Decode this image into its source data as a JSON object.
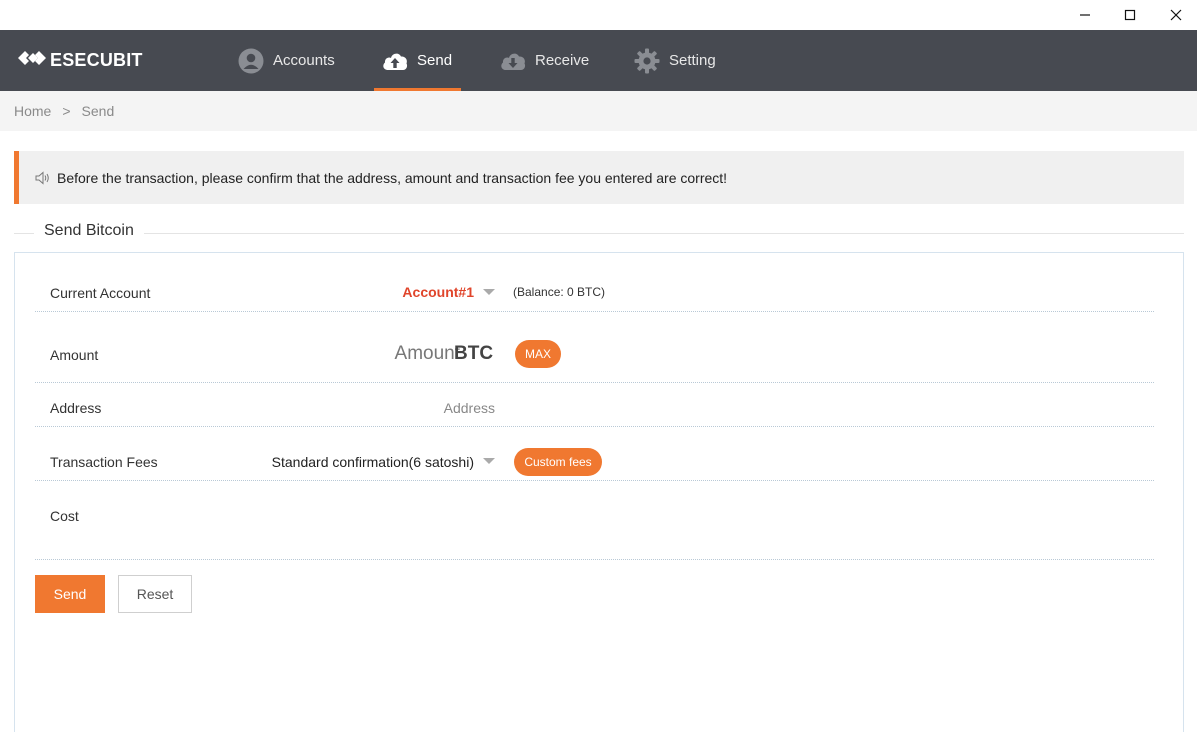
{
  "window": {
    "controls": [
      "minimize-icon",
      "maximize-icon",
      "close-icon"
    ]
  },
  "brand": {
    "name": "ESECUBIT",
    "logo_icon": "diamond-logo-icon"
  },
  "nav": {
    "items": [
      {
        "label": "Accounts",
        "icon": "user-icon",
        "active": false
      },
      {
        "label": "Send",
        "icon": "cloud-upload-icon",
        "active": true
      },
      {
        "label": "Receive",
        "icon": "cloud-download-icon",
        "active": false
      },
      {
        "label": "Setting",
        "icon": "gear-icon",
        "active": false
      }
    ]
  },
  "breadcrumb": {
    "home": "Home",
    "separator": ">",
    "current": "Send"
  },
  "notice": {
    "icon": "speaker-icon",
    "text": "Before the transaction, please confirm that the address, amount and transaction fee you entered are correct!"
  },
  "form": {
    "title": "Send Bitcoin",
    "current_account": {
      "label": "Current Account",
      "value": "Account#1",
      "balance": "(Balance: 0 BTC)"
    },
    "amount": {
      "label": "Amount",
      "placeholder": "Amount",
      "unit": "BTC",
      "max_label": "MAX"
    },
    "address": {
      "label": "Address",
      "placeholder": "Address"
    },
    "fees": {
      "label": "Transaction Fees",
      "value": "Standard confirmation(6 satoshi)",
      "custom_label": "Custom fees"
    },
    "cost": {
      "label": "Cost"
    },
    "send_label": "Send",
    "reset_label": "Reset"
  },
  "colors": {
    "accent": "#f07830",
    "navbar": "#474a51",
    "account_highlight": "#e0452b"
  }
}
